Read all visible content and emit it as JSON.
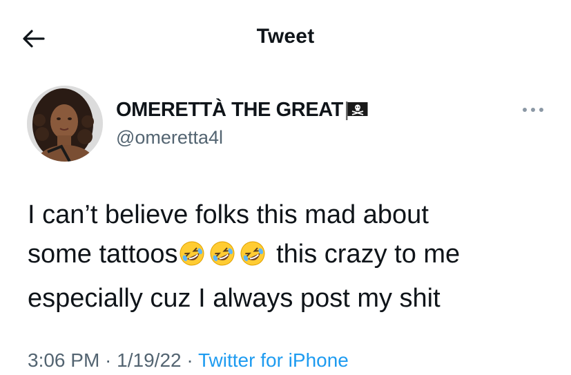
{
  "header": {
    "title": "Tweet"
  },
  "author": {
    "display_name": "OMERETTÀ THE GREAT",
    "handle": "@omeretta4l"
  },
  "tweet": {
    "line1": "I can’t believe folks this mad about",
    "line2_start": "some tattoos",
    "line2_end": " this crazy to me",
    "line3": "especially cuz I always post my shit",
    "emoji_count": 3
  },
  "meta": {
    "time": "3:06 PM",
    "separator1": " · ",
    "date": "1/19/22",
    "separator2": " · ",
    "source": "Twitter for iPhone"
  },
  "icons": {
    "back": "arrow-left-icon",
    "flag": "pirate-flag-icon",
    "more": "more-horizontal-icon",
    "emoji": "rolling-on-floor-laughing-emoji"
  },
  "colors": {
    "text": "#0f1419",
    "secondary": "#536471",
    "link": "#1d9bf0"
  }
}
